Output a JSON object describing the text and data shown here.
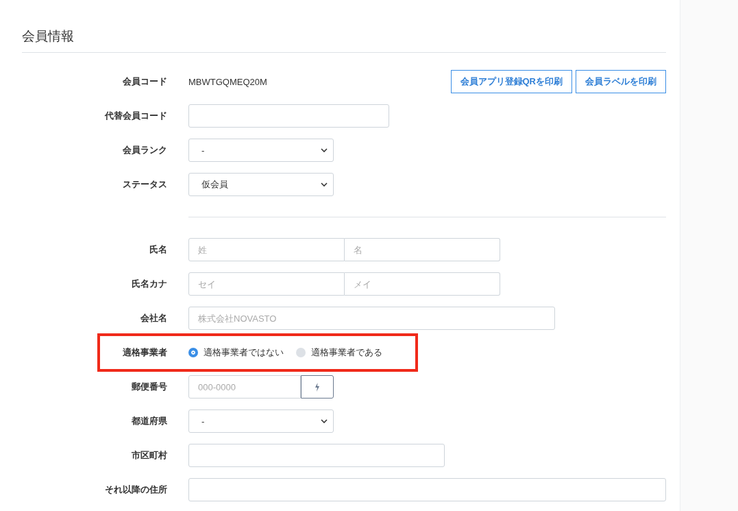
{
  "section": {
    "title": "会員情報"
  },
  "rows": [
    {
      "kind": "text",
      "label": "会員コード",
      "value": "MBWTGQMEQ20M",
      "buttons": [
        "会員アプリ登録QRを印刷",
        "会員ラベルを印刷"
      ],
      "highlighted": false
    },
    {
      "kind": "input",
      "label": "代替会員コード",
      "highlighted": false
    },
    {
      "kind": "select",
      "label": "会員ランク",
      "value": "-",
      "highlighted": false
    },
    {
      "kind": "select",
      "label": "ステータス",
      "value": "仮会員",
      "highlighted": false
    },
    {
      "kind": "divider"
    },
    {
      "kind": "pair",
      "label": "氏名",
      "placeholders": [
        "姓",
        "名"
      ],
      "highlighted": false
    },
    {
      "kind": "pair",
      "label": "氏名カナ",
      "placeholders": [
        "セイ",
        "メイ"
      ],
      "highlighted": false
    },
    {
      "kind": "input",
      "label": "会社名",
      "placeholder": "株式会社NOVASTO",
      "highlighted": false
    },
    {
      "kind": "radio",
      "label": "適格事業者",
      "options": [
        {
          "label": "適格事業者ではない",
          "selected": true
        },
        {
          "label": "適格事業者である",
          "selected": false
        }
      ],
      "highlighted": true
    },
    {
      "kind": "postal",
      "label": "郵便番号",
      "placeholder": "000-0000",
      "highlighted": false
    },
    {
      "kind": "select",
      "label": "都道府県",
      "value": "-",
      "highlighted": false
    },
    {
      "kind": "input",
      "label": "市区町村",
      "highlighted": false
    },
    {
      "kind": "input",
      "label": "それ以降の住所",
      "highlighted": false
    }
  ]
}
